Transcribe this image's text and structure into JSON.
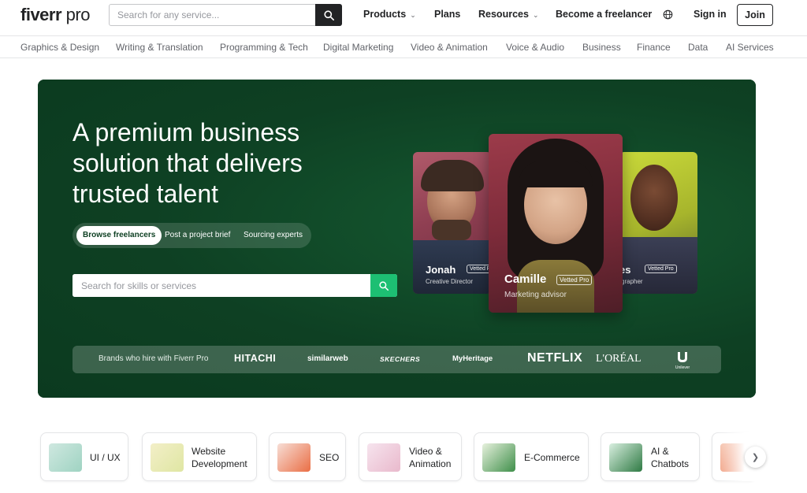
{
  "header": {
    "logo_text": "fiverr",
    "logo_suffix": " pro",
    "search_placeholder": "Search for any service...",
    "nav": {
      "products": "Products",
      "plans": "Plans",
      "resources": "Resources",
      "become_freelancer": "Become a freelancer",
      "sign_in": "Sign in",
      "join": "Join"
    }
  },
  "categories": [
    "Graphics & Design",
    "Writing & Translation",
    "Programming & Tech",
    "Digital Marketing",
    "Video & Animation",
    "Voice & Audio",
    "Business",
    "Finance",
    "Data",
    "AI Services"
  ],
  "hero": {
    "title": "A premium business solution that delivers trusted talent",
    "tabs": [
      "Browse freelancers",
      "Post a project brief",
      "Sourcing experts"
    ],
    "active_tab": "Browse freelancers",
    "search_placeholder": "Search for skills or services",
    "cards": {
      "jonah": {
        "name": "Jonah",
        "badge": "Vetted P",
        "role": "Creative Director"
      },
      "camille": {
        "name": "Camille",
        "badge": "Vetted Pro",
        "role": "Marketing advisor"
      },
      "right": {
        "name": "es",
        "badge": "Vetted Pro",
        "role": "grapher"
      }
    },
    "brands_label": "Brands who hire with Fiverr Pro",
    "brands": [
      "HITACHI",
      "similarweb",
      "SKECHERS",
      "MyHeritage",
      "NETFLIX",
      "L'ORÉAL",
      "Unilever"
    ]
  },
  "services": [
    {
      "label": "UI / UX"
    },
    {
      "label": "Website Development"
    },
    {
      "label": "SEO"
    },
    {
      "label": "Video & Animation"
    },
    {
      "label": "E-Commerce"
    },
    {
      "label": "AI & Chatbots"
    }
  ],
  "colors": {
    "brand_green": "#1dbf73",
    "hero_bg": "#0e4023",
    "text_dark": "#222325"
  }
}
